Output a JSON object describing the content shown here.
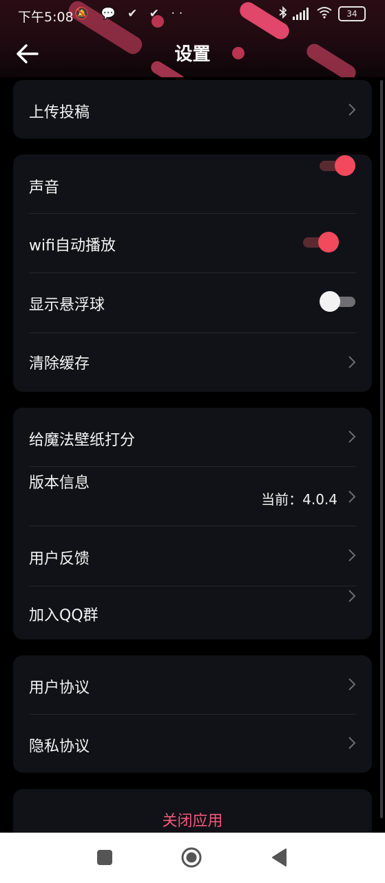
{
  "status_bar": {
    "time": "下午5:08",
    "left_icons": "🔕 💬 ✔ ✔ ··",
    "battery": "34"
  },
  "header": {
    "title": "设置",
    "back_icon": "arrow-left-icon"
  },
  "sections": {
    "upload": {
      "label": "上传投稿"
    },
    "sound": {
      "label": "声音",
      "on": true
    },
    "wifi_autoplay": {
      "label": "wifi自动播放",
      "on": true
    },
    "floating_ball": {
      "label": "显示悬浮球",
      "on": false
    },
    "clear_cache": {
      "label": "清除缓存"
    },
    "rate": {
      "label": "给魔法壁纸打分"
    },
    "version": {
      "label": "版本信息",
      "value": "当前：4.0.4"
    },
    "feedback": {
      "label": "用户反馈"
    },
    "qq_group": {
      "label": "加入QQ群"
    },
    "user_agreement": {
      "label": "用户协议"
    },
    "privacy": {
      "label": "隐私协议"
    },
    "close_app": {
      "label": "关闭应用"
    }
  },
  "colors": {
    "accent": "#f2495d",
    "close_text": "#f2577a",
    "card_bg": "#111217"
  },
  "nav": {
    "recent_icon": "square-icon",
    "home_icon": "circle-icon",
    "back_icon": "triangle-back-icon"
  }
}
